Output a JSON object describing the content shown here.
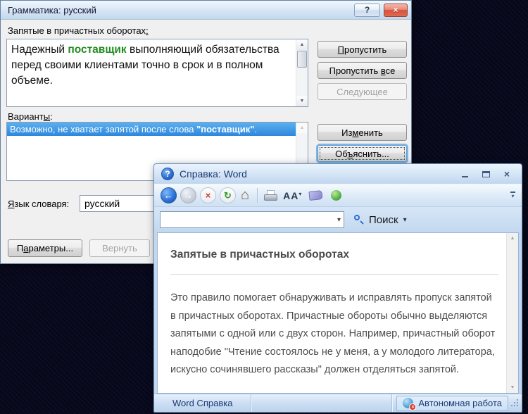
{
  "colors": {
    "highlight_green": "#1f8c1f",
    "selection_blue": "#3390e4",
    "close_red": "#d5523c",
    "chrome_blue": "#c3d8f0"
  },
  "icons": {
    "question": "?",
    "close": "×",
    "arrow_up": "▲",
    "arrow_down": "▼",
    "dropdown": "▾",
    "back": "←",
    "forward": "→",
    "stop": "×",
    "refresh": "↻",
    "home": "⌂",
    "font_size": "AA"
  },
  "grammar_dialog": {
    "title": "Грамматика: русский",
    "error_label": {
      "pre": "Запятые в причастных оборотах",
      "key": ":",
      "post": ""
    },
    "sentence": {
      "pre": "Надежный ",
      "highlight": "поставщик",
      "post": " выполняющий обязательства перед своими клиентами точно в срок и в полном объеме."
    },
    "suggestions_label": {
      "pre": "Вариант",
      "key": "ы",
      "post": ":"
    },
    "suggestion": {
      "pre": "Возможно, не хватает запятой после слова ",
      "bold": "\"поставщик\"",
      "post": "."
    },
    "language_label": {
      "pre": "",
      "key": "Я",
      "post": "зык словаря:"
    },
    "language_value": "русский",
    "buttons": {
      "skip": {
        "pre": "",
        "key": "П",
        "post": "ропустить"
      },
      "skip_all": {
        "pre": "Пропустить ",
        "key": "в",
        "post": "се"
      },
      "next": {
        "pre": "Следующее",
        "key": "",
        "post": ""
      },
      "change": {
        "pre": "Из",
        "key": "м",
        "post": "енить"
      },
      "explain": {
        "pre": "Об",
        "key": "ъ",
        "post": "яснить..."
      },
      "options": {
        "pre": "П",
        "key": "а",
        "post": "раметры..."
      },
      "undo": {
        "pre": "Вернуть",
        "key": "",
        "post": ""
      }
    }
  },
  "help_window": {
    "title": "Справка: Word",
    "search": {
      "value": "",
      "button_label": "Поиск"
    },
    "content": {
      "heading": "Запятые в причастных оборотах",
      "paragraph": "Это правило помогает обнаруживать и исправлять пропуск запятой в причастных оборотах. Причастные обороты обычно выделяются запятыми с одной или с двух сторон. Например, причастный оборот наподобие \"Чтение состоялось не у меня, а у молодого литератора, искусно сочинявшего рассказы\" должен отделяться запятой."
    },
    "statusbar": {
      "left": "Word Справка",
      "right": "Автономная работа"
    }
  }
}
